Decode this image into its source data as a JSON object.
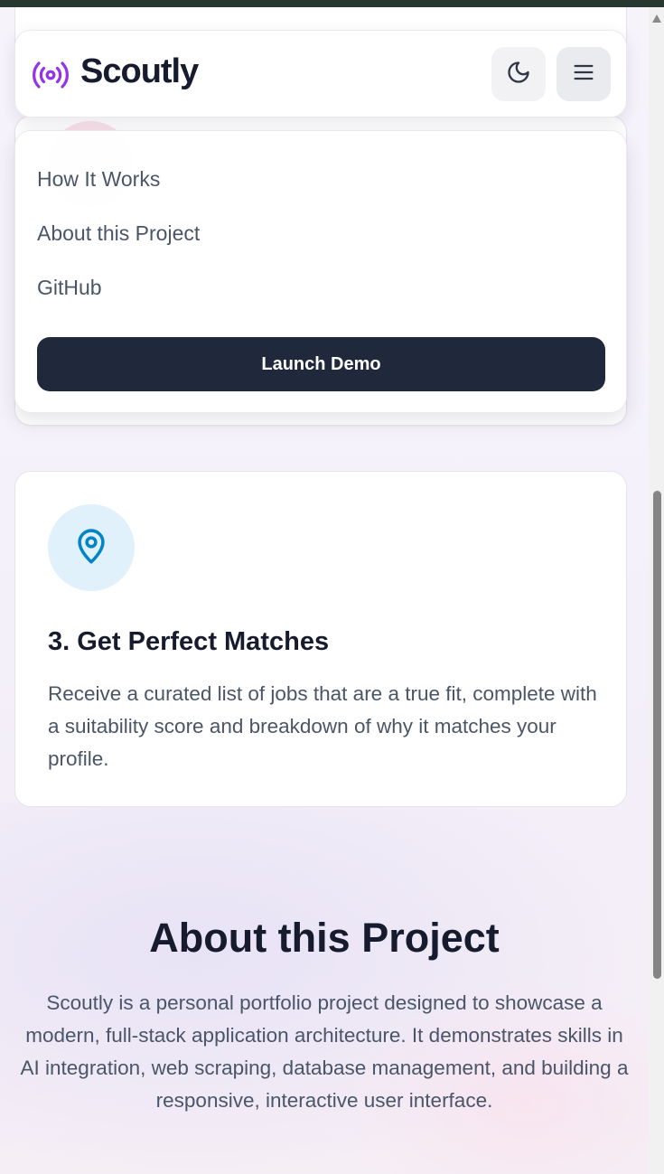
{
  "header": {
    "brand": "Scoutly",
    "theme_toggle_icon": "moon-icon",
    "menu_icon": "hamburger-menu-icon",
    "logo_icon": "broadcast-icon",
    "accent_color": "#9333ea"
  },
  "menu": {
    "items": [
      {
        "label": "How It Works"
      },
      {
        "label": "About this Project"
      },
      {
        "label": "GitHub"
      }
    ],
    "cta_label": "Launch Demo"
  },
  "steps": {
    "step3": {
      "icon": "map-pin-icon",
      "title": "3. Get Perfect Matches",
      "description": "Receive a curated list of jobs that are a true fit, complete with a suitability score and breakdown of why it matches your profile."
    }
  },
  "about": {
    "title": "About this Project",
    "description": "Scoutly is a personal portfolio project designed to showcase a modern, full-stack application architecture. It demonstrates skills in AI integration, web scraping, database management, and building a responsive, interactive user interface."
  }
}
